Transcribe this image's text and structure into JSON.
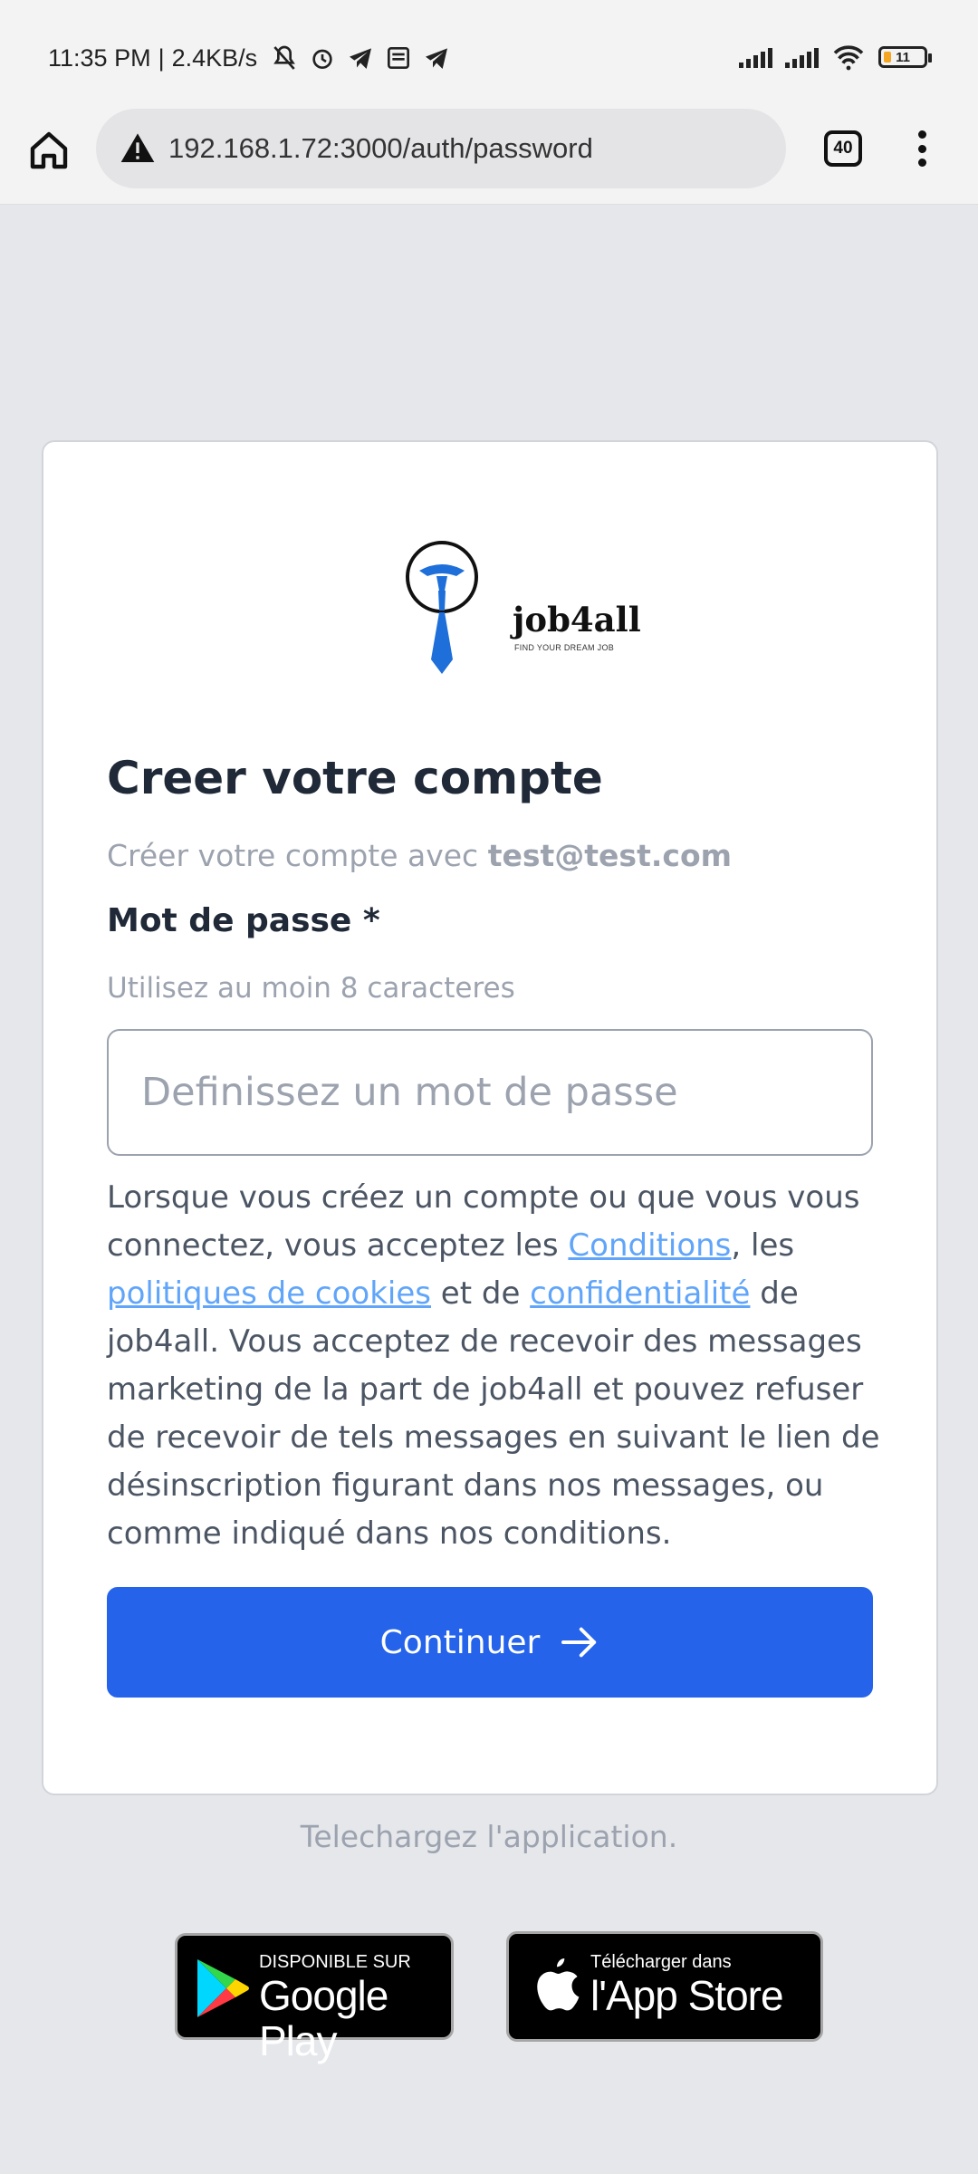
{
  "status_bar": {
    "time": "11:35 PM",
    "speed": "2.4KB/s",
    "battery": "11"
  },
  "browser": {
    "url": "192.168.1.72:3000/auth/password",
    "tab_count": "40"
  },
  "logo": {
    "name": "job4all",
    "tagline": "FIND YOUR DREAM JOB"
  },
  "form": {
    "title": "Creer votre compte",
    "subtitle_prefix": "Créer votre compte avec",
    "email": "test@test.com",
    "password_label": "Mot de passe *",
    "password_hint": "Utilisez au moin 8 caracteres",
    "password_placeholder": "Definissez un mot de passe",
    "terms": {
      "part1": "Lorsque vous créez un compte ou que vous vous connectez, vous acceptez les ",
      "link_conditions": "Conditions",
      "part2": ", les ",
      "link_cookies": "politiques de cookies",
      "part3": " et de ",
      "link_privacy": "confidentialité",
      "part4": " de job4all. Vous acceptez de recevoir des messages marketing de la part de job4all et pouvez refuser de recevoir de tels messages en suivant le lien de désinscription figurant dans nos messages, ou comme indiqué dans nos conditions."
    },
    "continue_label": "Continuer"
  },
  "download": {
    "text": "Telechargez l'application.",
    "google_play_small": "DISPONIBLE SUR",
    "google_play_big": "Google Play",
    "app_store_small": "Télécharger dans",
    "app_store_big": "l'App Store"
  },
  "colors": {
    "primary": "#2563eb",
    "link": "#60a5fa",
    "logo_blue": "#1e6fd9"
  }
}
